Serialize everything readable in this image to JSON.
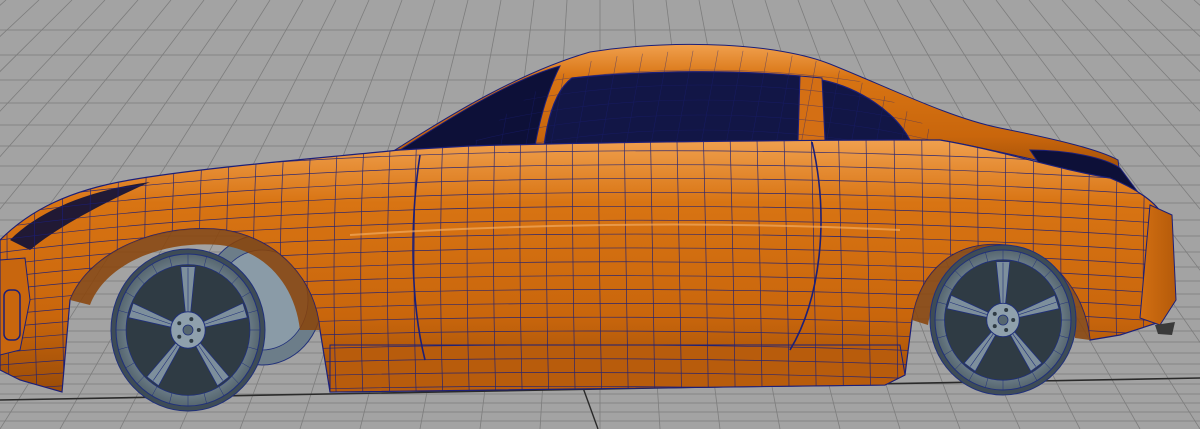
{
  "viewport": {
    "background": "#a3a3a3",
    "grid_color": "#7d7d7d",
    "grid_axis_color": "#2a2a2a"
  },
  "model": {
    "body_color": "#d87413",
    "body_dark": "#8a4308",
    "body_light": "#f3a55a",
    "wireframe_color": "#1c1f78",
    "glass_color": "#0d1038",
    "wheel_color": "#7d8f9c",
    "wheel_dark": "#3e4c56",
    "wheel_wire": "#20307a"
  }
}
